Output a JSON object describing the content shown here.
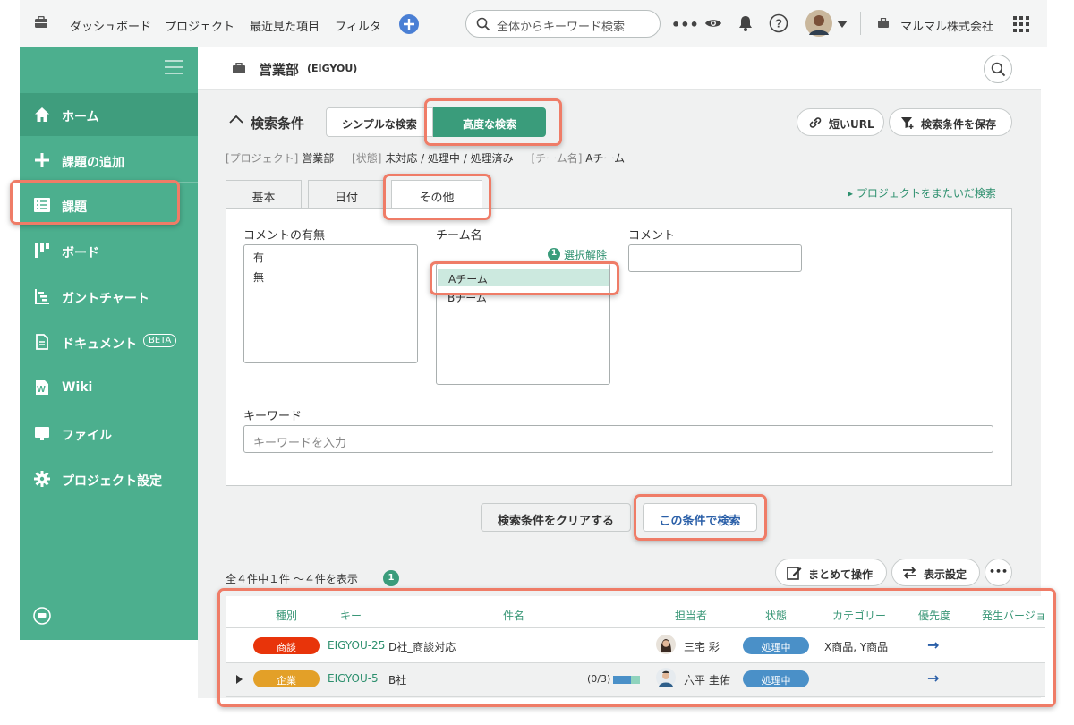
{
  "topbar": {
    "nav": [
      "ダッシュボード",
      "プロジェクト",
      "最近見た項目",
      "フィルタ"
    ],
    "search_placeholder": "全体からキーワード検索",
    "org_name": "マルマル株式会社"
  },
  "sidebar": {
    "items": [
      {
        "label": "ホーム",
        "icon": "home-icon"
      },
      {
        "label": "課題の追加",
        "icon": "plus-icon"
      },
      {
        "label": "課題",
        "icon": "list-icon"
      },
      {
        "label": "ボード",
        "icon": "board-icon"
      },
      {
        "label": "ガントチャート",
        "icon": "gantt-icon"
      },
      {
        "label": "ドキュメント",
        "icon": "document-icon",
        "badge": "BETA"
      },
      {
        "label": "Wiki",
        "icon": "wiki-icon"
      },
      {
        "label": "ファイル",
        "icon": "folder-icon"
      },
      {
        "label": "プロジェクト設定",
        "icon": "gear-icon"
      }
    ]
  },
  "header": {
    "project_name": "営業部",
    "project_key": "(EIGYOU)"
  },
  "search": {
    "title": "検索条件",
    "simple_label": "シンプルな検索",
    "advanced_label": "高度な検索",
    "short_url_label": "短いURL",
    "save_label": "検索条件を保存",
    "summary": [
      {
        "key": "[プロジェクト]",
        "value": "営業部"
      },
      {
        "key": "[状態]",
        "value": "未対応 / 処理中 / 処理済み"
      },
      {
        "key": "[チーム名]",
        "value": "Aチーム"
      }
    ],
    "tabs": [
      "基本",
      "日付",
      "その他"
    ],
    "cross_project_label": "▸ プロジェクトをまたいだ検索",
    "comment_presence": {
      "label": "コメントの有無",
      "options": [
        "有",
        "無"
      ]
    },
    "team": {
      "label": "チーム名",
      "count": "1",
      "clear_label": "選択解除",
      "options": [
        "Aチーム",
        "Bチーム"
      ]
    },
    "comment_label": "コメント",
    "keyword_label": "キーワード",
    "keyword_placeholder": "キーワードを入力",
    "clear_button": "検索条件をクリアする",
    "search_button": "この条件で検索"
  },
  "results": {
    "summary": "全４件中１件 ～４件を表示",
    "filter_count": "1",
    "bulk_label": "まとめて操作",
    "display_label": "表示設定",
    "columns": [
      "種別",
      "キー",
      "件名",
      "担当者",
      "状態",
      "カテゴリー",
      "優先度",
      "発生バージョ"
    ],
    "rows": [
      {
        "type": "商談",
        "type_color": "#e8340a",
        "key": "EIGYOU-25",
        "subject": "D社_商談対応",
        "assignee": "三宅 彩",
        "status": "処理中",
        "category": "X商品, Y商品",
        "priority": "→",
        "subtasks": ""
      },
      {
        "type": "企業",
        "type_color": "#e3a028",
        "key": "EIGYOU-5",
        "subject": "B社",
        "assignee": "六平 圭佑",
        "status": "処理中",
        "category": "",
        "priority": "→",
        "subtasks": "(0/3)"
      }
    ]
  },
  "colors": {
    "brand": "#4caf8e",
    "highlight": "#ef7c67",
    "status": "#4a90c8"
  }
}
